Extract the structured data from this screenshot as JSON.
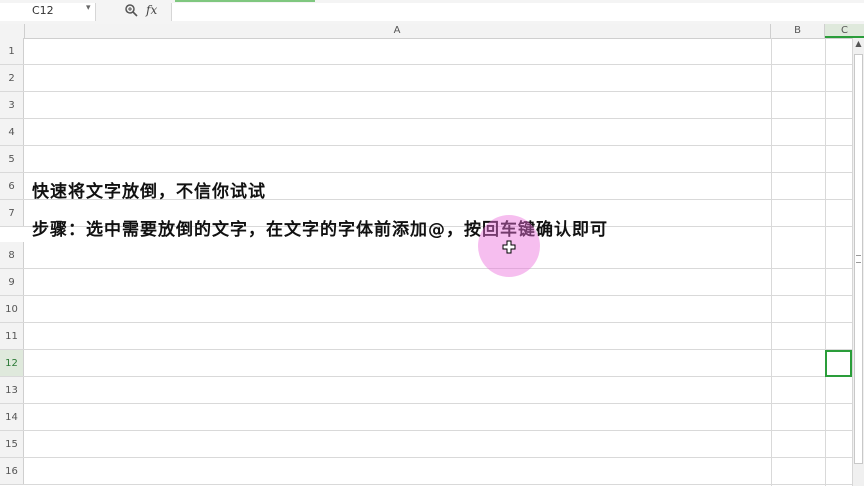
{
  "formula_bar": {
    "cell_ref": "C12",
    "dropdown_arrow": "▾",
    "zoom_icon": "zoom-icon",
    "fx_label": "fx",
    "formula_value": ""
  },
  "columns": [
    "A",
    "B",
    "C"
  ],
  "rows": [
    {
      "num": "1",
      "text": ""
    },
    {
      "num": "2",
      "text": ""
    },
    {
      "num": "3",
      "text": ""
    },
    {
      "num": "4",
      "text": ""
    },
    {
      "num": "5",
      "text": ""
    },
    {
      "num": "6",
      "text": "快速将文字放倒，不信你试试"
    },
    {
      "num": "7",
      "text": "步骤：选中需要放倒的文字，在文字的字体前添加@，按回车键确认即可"
    },
    {
      "num": "8",
      "text": ""
    },
    {
      "num": "9",
      "text": ""
    },
    {
      "num": "10",
      "text": ""
    },
    {
      "num": "11",
      "text": ""
    },
    {
      "num": "12",
      "text": ""
    },
    {
      "num": "13",
      "text": ""
    },
    {
      "num": "14",
      "text": ""
    },
    {
      "num": "15",
      "text": ""
    },
    {
      "num": "16",
      "text": ""
    }
  ],
  "selected_cell": "C12",
  "colors": {
    "accent": "#2a9d3a",
    "cursor_highlight": "#ec6edc"
  }
}
